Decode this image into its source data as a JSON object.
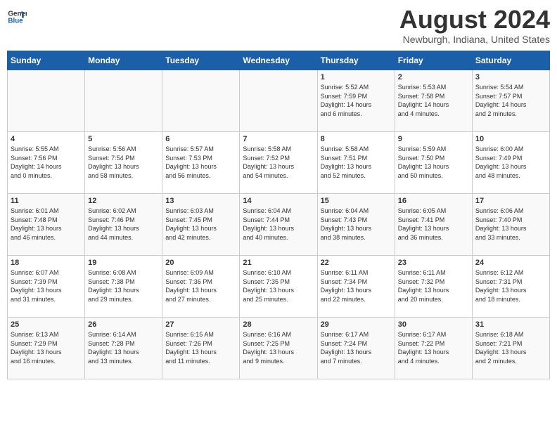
{
  "logo": {
    "line1": "General",
    "line2": "Blue"
  },
  "title": "August 2024",
  "subtitle": "Newburgh, Indiana, United States",
  "days_header": [
    "Sunday",
    "Monday",
    "Tuesday",
    "Wednesday",
    "Thursday",
    "Friday",
    "Saturday"
  ],
  "weeks": [
    [
      {
        "day": "",
        "info": ""
      },
      {
        "day": "",
        "info": ""
      },
      {
        "day": "",
        "info": ""
      },
      {
        "day": "",
        "info": ""
      },
      {
        "day": "1",
        "info": "Sunrise: 5:52 AM\nSunset: 7:59 PM\nDaylight: 14 hours\nand 6 minutes."
      },
      {
        "day": "2",
        "info": "Sunrise: 5:53 AM\nSunset: 7:58 PM\nDaylight: 14 hours\nand 4 minutes."
      },
      {
        "day": "3",
        "info": "Sunrise: 5:54 AM\nSunset: 7:57 PM\nDaylight: 14 hours\nand 2 minutes."
      }
    ],
    [
      {
        "day": "4",
        "info": "Sunrise: 5:55 AM\nSunset: 7:56 PM\nDaylight: 14 hours\nand 0 minutes."
      },
      {
        "day": "5",
        "info": "Sunrise: 5:56 AM\nSunset: 7:54 PM\nDaylight: 13 hours\nand 58 minutes."
      },
      {
        "day": "6",
        "info": "Sunrise: 5:57 AM\nSunset: 7:53 PM\nDaylight: 13 hours\nand 56 minutes."
      },
      {
        "day": "7",
        "info": "Sunrise: 5:58 AM\nSunset: 7:52 PM\nDaylight: 13 hours\nand 54 minutes."
      },
      {
        "day": "8",
        "info": "Sunrise: 5:58 AM\nSunset: 7:51 PM\nDaylight: 13 hours\nand 52 minutes."
      },
      {
        "day": "9",
        "info": "Sunrise: 5:59 AM\nSunset: 7:50 PM\nDaylight: 13 hours\nand 50 minutes."
      },
      {
        "day": "10",
        "info": "Sunrise: 6:00 AM\nSunset: 7:49 PM\nDaylight: 13 hours\nand 48 minutes."
      }
    ],
    [
      {
        "day": "11",
        "info": "Sunrise: 6:01 AM\nSunset: 7:48 PM\nDaylight: 13 hours\nand 46 minutes."
      },
      {
        "day": "12",
        "info": "Sunrise: 6:02 AM\nSunset: 7:46 PM\nDaylight: 13 hours\nand 44 minutes."
      },
      {
        "day": "13",
        "info": "Sunrise: 6:03 AM\nSunset: 7:45 PM\nDaylight: 13 hours\nand 42 minutes."
      },
      {
        "day": "14",
        "info": "Sunrise: 6:04 AM\nSunset: 7:44 PM\nDaylight: 13 hours\nand 40 minutes."
      },
      {
        "day": "15",
        "info": "Sunrise: 6:04 AM\nSunset: 7:43 PM\nDaylight: 13 hours\nand 38 minutes."
      },
      {
        "day": "16",
        "info": "Sunrise: 6:05 AM\nSunset: 7:41 PM\nDaylight: 13 hours\nand 36 minutes."
      },
      {
        "day": "17",
        "info": "Sunrise: 6:06 AM\nSunset: 7:40 PM\nDaylight: 13 hours\nand 33 minutes."
      }
    ],
    [
      {
        "day": "18",
        "info": "Sunrise: 6:07 AM\nSunset: 7:39 PM\nDaylight: 13 hours\nand 31 minutes."
      },
      {
        "day": "19",
        "info": "Sunrise: 6:08 AM\nSunset: 7:38 PM\nDaylight: 13 hours\nand 29 minutes."
      },
      {
        "day": "20",
        "info": "Sunrise: 6:09 AM\nSunset: 7:36 PM\nDaylight: 13 hours\nand 27 minutes."
      },
      {
        "day": "21",
        "info": "Sunrise: 6:10 AM\nSunset: 7:35 PM\nDaylight: 13 hours\nand 25 minutes."
      },
      {
        "day": "22",
        "info": "Sunrise: 6:11 AM\nSunset: 7:34 PM\nDaylight: 13 hours\nand 22 minutes."
      },
      {
        "day": "23",
        "info": "Sunrise: 6:11 AM\nSunset: 7:32 PM\nDaylight: 13 hours\nand 20 minutes."
      },
      {
        "day": "24",
        "info": "Sunrise: 6:12 AM\nSunset: 7:31 PM\nDaylight: 13 hours\nand 18 minutes."
      }
    ],
    [
      {
        "day": "25",
        "info": "Sunrise: 6:13 AM\nSunset: 7:29 PM\nDaylight: 13 hours\nand 16 minutes."
      },
      {
        "day": "26",
        "info": "Sunrise: 6:14 AM\nSunset: 7:28 PM\nDaylight: 13 hours\nand 13 minutes."
      },
      {
        "day": "27",
        "info": "Sunrise: 6:15 AM\nSunset: 7:26 PM\nDaylight: 13 hours\nand 11 minutes."
      },
      {
        "day": "28",
        "info": "Sunrise: 6:16 AM\nSunset: 7:25 PM\nDaylight: 13 hours\nand 9 minutes."
      },
      {
        "day": "29",
        "info": "Sunrise: 6:17 AM\nSunset: 7:24 PM\nDaylight: 13 hours\nand 7 minutes."
      },
      {
        "day": "30",
        "info": "Sunrise: 6:17 AM\nSunset: 7:22 PM\nDaylight: 13 hours\nand 4 minutes."
      },
      {
        "day": "31",
        "info": "Sunrise: 6:18 AM\nSunset: 7:21 PM\nDaylight: 13 hours\nand 2 minutes."
      }
    ]
  ]
}
